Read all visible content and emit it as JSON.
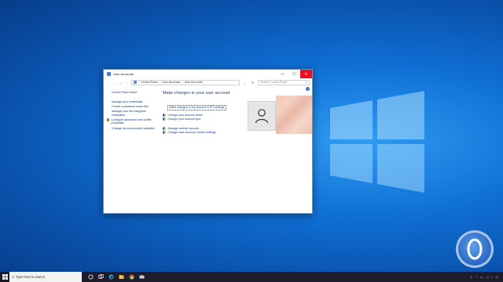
{
  "window": {
    "title": "User Accounts",
    "buttons": {
      "minimize": "—",
      "maximize": "☐",
      "close": "✕"
    }
  },
  "addressbar": {
    "breadcrumb": [
      "Control Panel",
      "User Accounts",
      "User Accounts"
    ],
    "search_placeholder": "Search Control Panel"
  },
  "left_pane": {
    "home": "Control Panel Home",
    "links": [
      "Manage your credentials",
      "Create a password reset disk",
      "Manage your file encryption certificates",
      "Configure advanced user profile properties",
      "Change my environment variables"
    ]
  },
  "main": {
    "heading": "Make changes to your user account",
    "pc_settings_link": "Make changes to my account in PC settings",
    "actions_top": [
      "Change your account name",
      "Change your account type"
    ],
    "actions_bottom": [
      "Manage another account",
      "Change User Account Control settings"
    ]
  },
  "taskbar": {
    "search_placeholder": "Type here to search"
  },
  "icons": {
    "help": "help-icon",
    "shield": "uac-shield-icon",
    "avatar": "user-avatar-icon"
  },
  "colors": {
    "link": "#0b3b8c",
    "close_button": "#e81123",
    "desktop": "#0f6fd4"
  }
}
